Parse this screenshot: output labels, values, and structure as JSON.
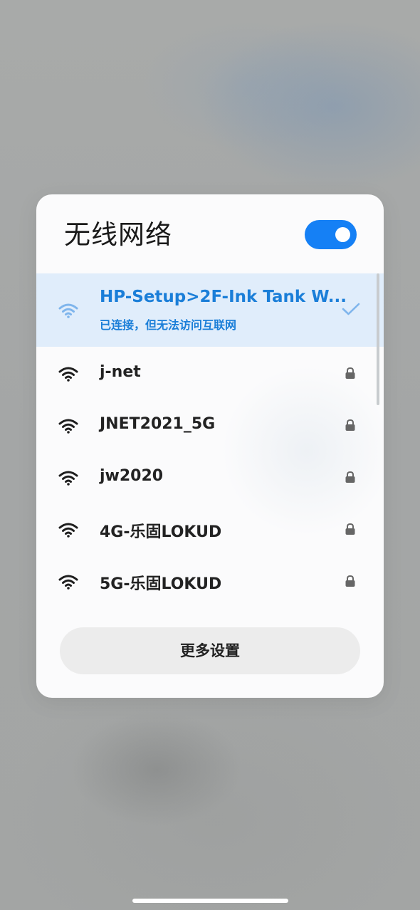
{
  "panel": {
    "title": "无线网络",
    "wifi_enabled": true,
    "accent_color": "#1580f5"
  },
  "networks": [
    {
      "name": "HP-Setup>2F-Ink Tank W...",
      "status": "已连接，但无法访问互联网",
      "connected": true,
      "secured": false
    },
    {
      "name": "j-net",
      "status": "",
      "connected": false,
      "secured": true
    },
    {
      "name": "JNET2021_5G",
      "status": "",
      "connected": false,
      "secured": true
    },
    {
      "name": "jw2020",
      "status": "",
      "connected": false,
      "secured": true
    },
    {
      "name": "4G-乐固LOKUD",
      "status": "",
      "connected": false,
      "secured": true
    },
    {
      "name": "5G-乐固LOKUD",
      "status": "",
      "connected": false,
      "secured": true
    }
  ],
  "footer": {
    "more_settings_label": "更多设置"
  },
  "icons": {
    "wifi": "wifi-icon",
    "lock": "lock-icon",
    "check": "check-icon"
  }
}
